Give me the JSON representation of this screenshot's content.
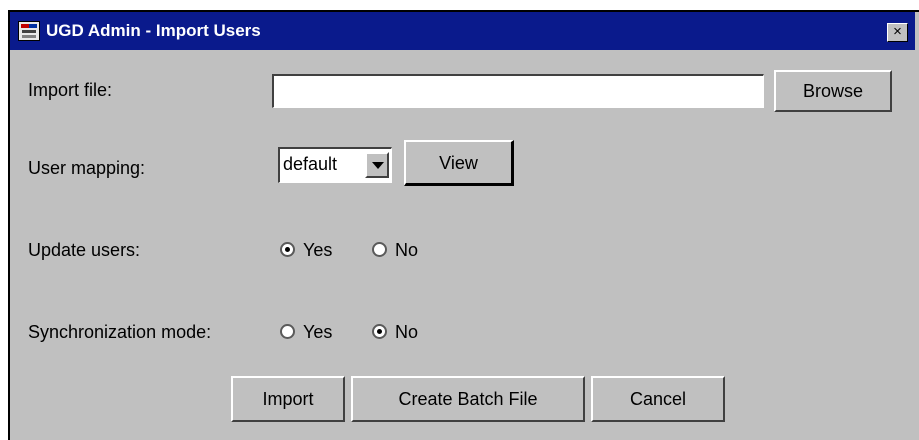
{
  "window": {
    "title": "UGD Admin - Import Users",
    "close_label": "×",
    "icon": "ugd-app-icon"
  },
  "form": {
    "import_file": {
      "label": "Import file:",
      "value": "",
      "browse_label": "Browse"
    },
    "user_mapping": {
      "label": "User mapping:",
      "selected": "default",
      "view_label": "View"
    },
    "update_users": {
      "label": "Update users:",
      "yes": "Yes",
      "no": "No",
      "selected": "Yes"
    },
    "sync_mode": {
      "label": "Synchronization mode:",
      "yes": "Yes",
      "no": "No",
      "selected": "No"
    }
  },
  "actions": {
    "import_label": "Import",
    "batch_label": "Create Batch File",
    "cancel_label": "Cancel"
  }
}
